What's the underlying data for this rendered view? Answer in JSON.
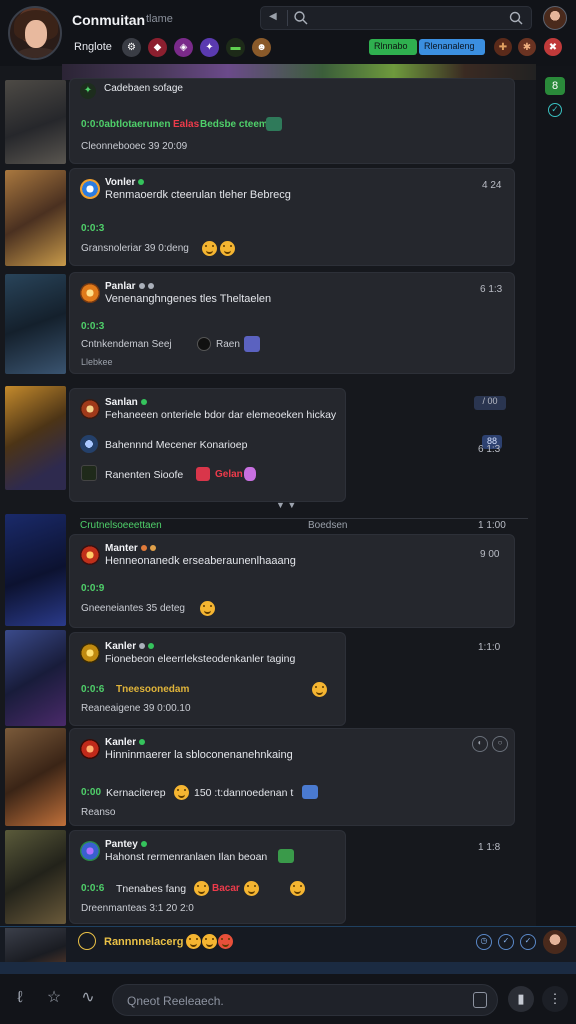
{
  "header": {
    "title": "Conmuitan",
    "subtitle": "tlame",
    "tag": "Rnglote",
    "pills": [
      "Rlnnabo",
      "Rlenanaleng"
    ]
  },
  "sidebar": {
    "badge": "8"
  },
  "feed": [
    {
      "name": "",
      "header_text": "Cadebaen sofage",
      "code": "0:0:0abtlotaerunen",
      "code_red": "Ealas",
      "code_green": "Bedsbe cteeml",
      "meta": "Cleonnebooec 39 20:09",
      "time": ""
    },
    {
      "name": "Vonler",
      "msg": "Renmaoerdk cteerulan tleher Bebrecg",
      "code": "0:0:3",
      "meta": "Gransnoleriar 39 0:deng",
      "time": "4 24"
    },
    {
      "name": "Panlar",
      "msg": "Venenanghngenes tles Theltaelen",
      "code": "0:0:3",
      "meta": "Cntnkendeman Seej",
      "meta2": "Raen",
      "extra": "Llebkee",
      "time": "6 1:3"
    },
    {
      "name": "Sanlan",
      "msg": "Fehaneeen onteriele bdor dar elemeoeken hickay",
      "line2": "Bahennnd Mecener Konarioep",
      "line3": "Ranenten Sioofe",
      "line3_red": "Gelan",
      "time": "/ 00",
      "chip": "88"
    },
    {
      "name": "Manter",
      "section_label": "Crutnelsoeeettaen",
      "section_right": "Boedsen",
      "section_time": "1 1:00",
      "msg": "Henneonanedk erseaberaunenlhaaang",
      "code": "0:0:9",
      "meta": "Gneeneiantes 35 deteg",
      "time": "9 00"
    },
    {
      "name": "Kanler",
      "msg": "Fionebeon eleerrleksteodenkanler taging",
      "code": "0:0:6",
      "code_yellow": "Tneesoonedam",
      "meta": "Reaneaigene 39 0:00.10",
      "time": "1:1:0"
    },
    {
      "name": "Kanler",
      "msg": "Hinninmaerer la sbloconenanehnkaing",
      "code": "0:00",
      "line2_a": "Kernaciterep",
      "line2_b": "150 :t:dannoedenan t",
      "meta": "Reanso",
      "time": ""
    },
    {
      "name": "Pantey",
      "msg": "Hahonst rermenranlaen Ilan beoan",
      "code": "0:0:6",
      "line2_a": "Tnenabes fang",
      "line2_red": "Bacar",
      "meta": "Dreenmanteas 3:1 20 2:0",
      "time": "1 1:8"
    }
  ],
  "now_playing": {
    "text": "Rannnnelacerg"
  },
  "composer": {
    "placeholder": "Qneot Reeleaech."
  }
}
